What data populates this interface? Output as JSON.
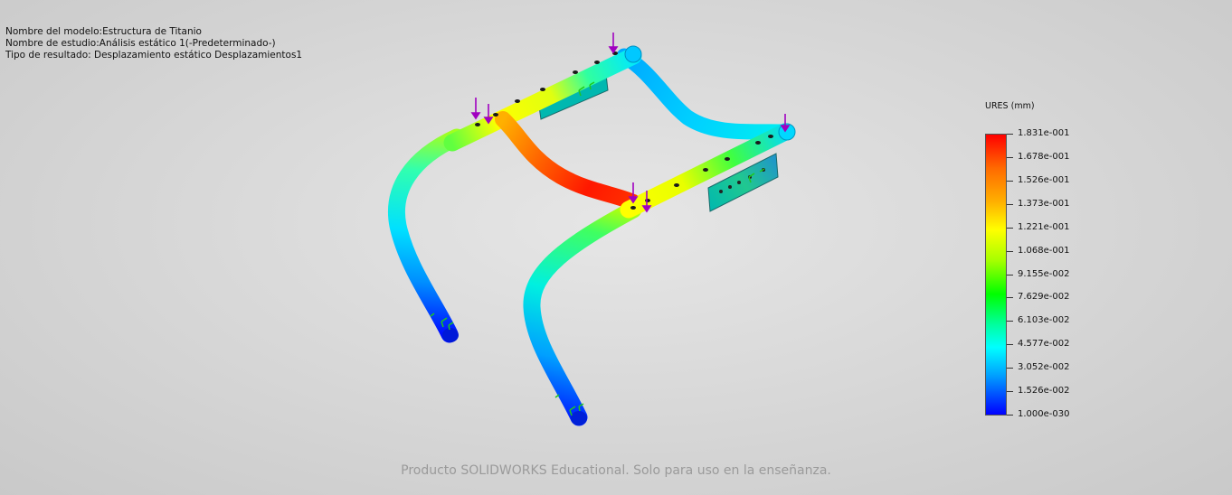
{
  "info": {
    "model_name": "Nombre del modelo:Estructura de Titanio",
    "study_name": "Nombre de estudio:Análisis estático 1(-Predeterminado-)",
    "result_type": "Tipo de resultado: Desplazamiento estático Desplazamientos1"
  },
  "legend": {
    "title": "URES (mm)",
    "labels": [
      "1.831e-001",
      "1.678e-001",
      "1.526e-001",
      "1.373e-001",
      "1.221e-001",
      "1.068e-001",
      "9.155e-002",
      "7.629e-002",
      "6.103e-002",
      "4.577e-002",
      "3.052e-002",
      "1.526e-002",
      "1.000e-030"
    ]
  },
  "watermark": "Producto SOLIDWORKS Educational. Solo para uso en la enseñanza.",
  "colors": {
    "max": "#ff0000",
    "min": "#0000ff",
    "load_arrow": "#a000c0",
    "fixture": "#2ecc2e"
  }
}
